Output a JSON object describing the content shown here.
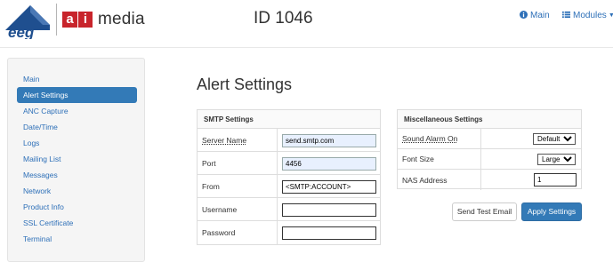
{
  "header": {
    "brand_left": "eeg",
    "brand_ai_a": "a",
    "brand_ai_i": "i",
    "brand_media": "media",
    "device_id": "ID 1046",
    "nav_main": "Main",
    "nav_modules": "Modules"
  },
  "sidebar": {
    "items": [
      {
        "label": "Main",
        "active": false
      },
      {
        "label": "Alert Settings",
        "active": true
      },
      {
        "label": "ANC Capture",
        "active": false
      },
      {
        "label": "Date/Time",
        "active": false
      },
      {
        "label": "Logs",
        "active": false
      },
      {
        "label": "Mailing List",
        "active": false
      },
      {
        "label": "Messages",
        "active": false
      },
      {
        "label": "Network",
        "active": false
      },
      {
        "label": "Product Info",
        "active": false
      },
      {
        "label": "SSL Certificate",
        "active": false
      },
      {
        "label": "Terminal",
        "active": false
      }
    ]
  },
  "main": {
    "title": "Alert Settings",
    "smtp": {
      "heading": "SMTP Settings",
      "server_label": "Server Name",
      "server_value": "send.smtp.com",
      "port_label": "Port",
      "port_value": "4456",
      "from_label": "From",
      "from_value": "<SMTP:ACCOUNT>",
      "username_label": "Username",
      "username_value": "",
      "password_label": "Password",
      "password_value": ""
    },
    "misc": {
      "heading": "Miscellaneous Settings",
      "sound_label": "Sound Alarm On",
      "sound_value": "Default",
      "font_label": "Font Size",
      "font_value": "Large",
      "nas_label": "NAS Address",
      "nas_value": "1"
    },
    "buttons": {
      "test_email": "Send Test Email",
      "apply": "Apply Settings"
    }
  },
  "colors": {
    "accent": "#337ab7",
    "brand_red": "#c8242b",
    "brand_blue": "#1f4f8f"
  }
}
